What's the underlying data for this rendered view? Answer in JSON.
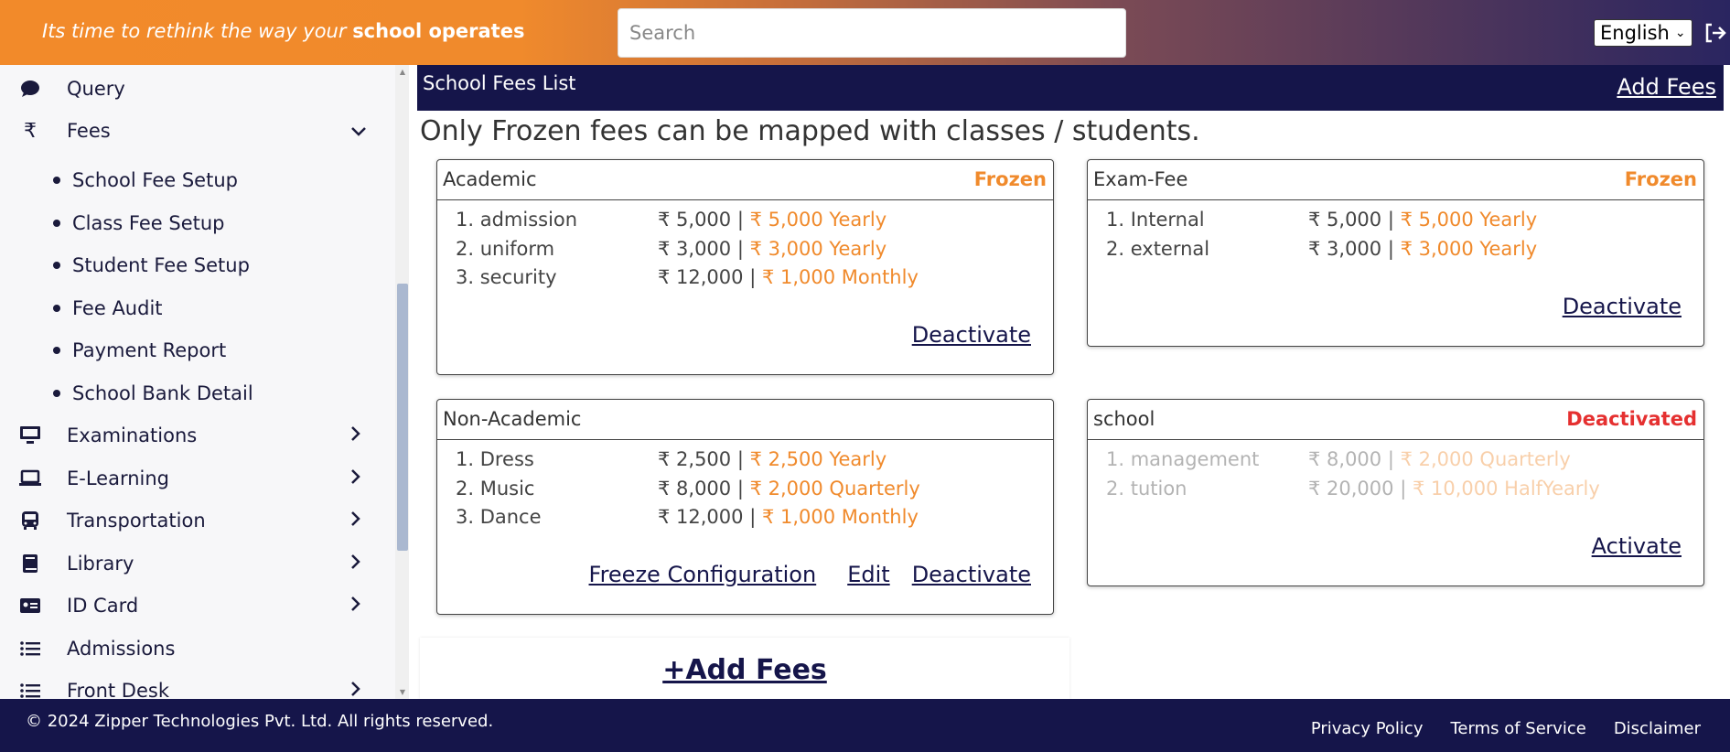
{
  "header": {
    "tagline_plain": "Its time to rethink the way your ",
    "tagline_bold": "school operates",
    "search_placeholder": "Search",
    "language": "English"
  },
  "sidebar": {
    "items": [
      {
        "label": "Query",
        "icon": "comment-icon"
      },
      {
        "label": "Fees",
        "icon": "rupee-icon",
        "expanded": true
      },
      {
        "label": "Examinations",
        "icon": "monitor-icon"
      },
      {
        "label": "E-Learning",
        "icon": "laptop-icon"
      },
      {
        "label": "Transportation",
        "icon": "bus-icon"
      },
      {
        "label": "Library",
        "icon": "book-icon"
      },
      {
        "label": "ID Card",
        "icon": "id-card-icon"
      },
      {
        "label": "Admissions",
        "icon": "list-icon"
      },
      {
        "label": "Front Desk",
        "icon": "list-icon"
      }
    ],
    "fees_submenu": [
      "School Fee Setup",
      "Class Fee Setup",
      "Student Fee Setup",
      "Fee Audit",
      "Payment Report",
      "School Bank Detail"
    ]
  },
  "main": {
    "title": "School Fees List",
    "add_fees_link": "Add Fees",
    "notice": "Only Frozen fees can be mapped with classes / students.",
    "add_fees_big": "+Add Fees",
    "cards": [
      {
        "name": "Academic",
        "status": "Frozen",
        "rows": [
          {
            "label": "1. admission",
            "amount": "₹ 5,000 |",
            "freq": "₹ 5,000 Yearly"
          },
          {
            "label": "2. uniform",
            "amount": "₹ 3,000 |",
            "freq": "₹ 3,000 Yearly"
          },
          {
            "label": "3. security",
            "amount": "₹ 12,000 |",
            "freq": "₹ 1,000 Monthly"
          }
        ],
        "actions": [
          "Deactivate"
        ]
      },
      {
        "name": "Exam-Fee",
        "status": "Frozen",
        "rows": [
          {
            "label": "1. Internal",
            "amount": "₹ 5,000 |",
            "freq": "₹ 5,000 Yearly"
          },
          {
            "label": "2. external",
            "amount": "₹ 3,000 |",
            "freq": "₹ 3,000 Yearly"
          }
        ],
        "actions": [
          "Deactivate"
        ]
      },
      {
        "name": "Non-Academic",
        "status": "",
        "rows": [
          {
            "label": "1. Dress",
            "amount": "₹ 2,500 |",
            "freq": "₹ 2,500 Yearly"
          },
          {
            "label": "2. Music",
            "amount": "₹ 8,000 |",
            "freq": "₹ 2,000 Quarterly"
          },
          {
            "label": "3. Dance",
            "amount": "₹ 12,000 |",
            "freq": "₹ 1,000 Monthly"
          }
        ],
        "actions": [
          "Freeze Configuration",
          "Edit",
          "Deactivate"
        ]
      },
      {
        "name": "school",
        "status": "Deactivated",
        "rows": [
          {
            "label": "1. management",
            "amount": "₹ 8,000 |",
            "freq": "₹ 2,000 Quarterly"
          },
          {
            "label": "2. tution",
            "amount": "₹ 20,000 |",
            "freq": "₹ 10,000 HalfYearly"
          }
        ],
        "actions": [
          "Activate"
        ]
      }
    ]
  },
  "footer": {
    "copyright": "© 2024 Zipper Technologies Pvt. Ltd. All rights reserved.",
    "links": [
      "Privacy Policy",
      "Terms of Service",
      "Disclaimer"
    ]
  },
  "colors": {
    "accent": "#f08a2c",
    "navy": "#15154a",
    "danger": "#e53030"
  }
}
